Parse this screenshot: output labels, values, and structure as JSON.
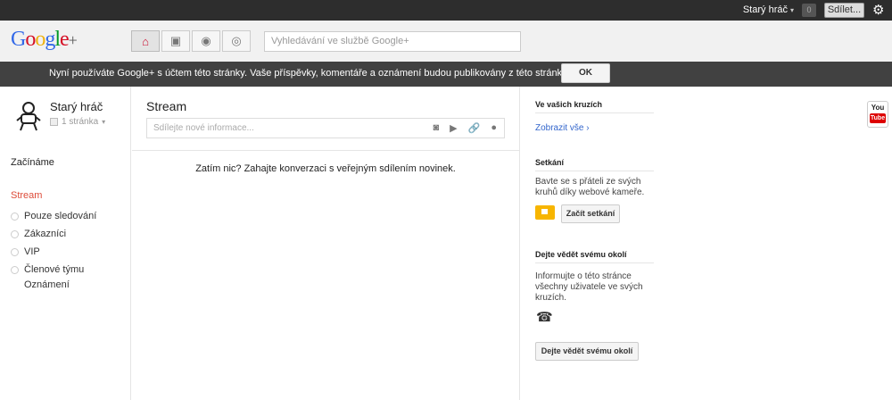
{
  "topbar": {
    "user_name": "Starý hráč",
    "notifications": "0",
    "share_label": "Sdílet...",
    "gear_icon": "gear-icon"
  },
  "header": {
    "logo": "Google",
    "logo_plus": "+",
    "nav_icons": [
      "home-icon",
      "photos-icon",
      "profile-icon",
      "circles-icon"
    ],
    "search_placeholder": "Vyhledávání ve službě Google+"
  },
  "banner": {
    "message": "Nyní používáte Google+ s účtem této stránky. Vaše příspěvky, komentáře a oznámení budou publikovány z této stránky.",
    "ok_label": "OK"
  },
  "sidebar": {
    "profile_name": "Starý hráč",
    "page_count": "1 stránka",
    "getting_started": "Začínáme",
    "stream": "Stream",
    "circles": [
      "Pouze sledování",
      "Zákazníci",
      "VIP",
      "Členové týmu"
    ],
    "notifications": "Oznámení"
  },
  "main": {
    "title": "Stream",
    "share_placeholder": "Sdílejte nové informace...",
    "share_tools": [
      "camera-icon",
      "video-icon",
      "link-icon",
      "location-icon"
    ],
    "empty_message": "Zatím nic? Zahajte konverzaci s veřejným sdílením novinek."
  },
  "right": {
    "circles_title": "Ve vašich kruzích",
    "show_all": "Zobrazit vše ›",
    "hangout_title": "Setkání",
    "hangout_text": "Bavte se s přáteli ze svých kruhů díky webové kameře.",
    "hangout_button": "Začít setkání",
    "promote_title": "Dejte vědět svému okolí",
    "promote_text": "Informujte o této stránce všechny uživatele ve svých kruzích.",
    "promote_button": "Dejte vědět svému okolí"
  },
  "youtube": {
    "top": "You",
    "bottom": "Tube"
  },
  "colors": {
    "topbar": "#2d2d2d",
    "banner": "#414141",
    "accent_red": "#dd4b39",
    "link_blue": "#3366cc"
  }
}
